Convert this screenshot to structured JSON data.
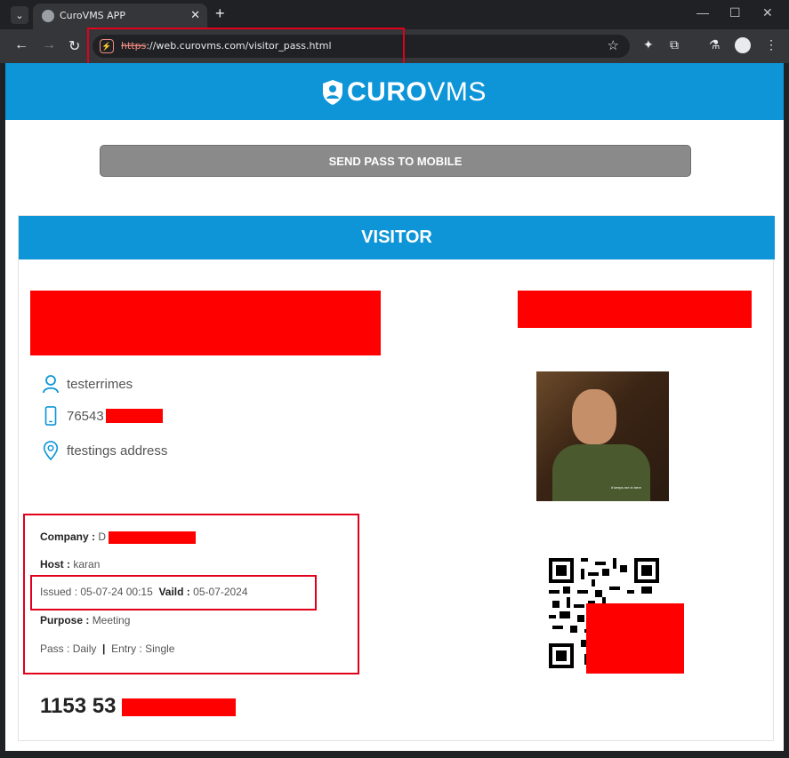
{
  "browser": {
    "tab_title": "CuroVMS APP",
    "tab_close": "✕",
    "new_tab": "+",
    "url_scheme": "https",
    "url_rest": "://web.curovms.com/visitor_pass.html"
  },
  "header": {
    "logo_bold": "CURO",
    "logo_thin": "VMS"
  },
  "actions": {
    "send_pass_label": "SEND PASS TO MOBILE"
  },
  "pass": {
    "title": "VISITOR",
    "visitor_name": "testerrimes",
    "phone": "76543",
    "address": "ftestings address",
    "company_label": "Company :",
    "company_value": "D",
    "host_label": "Host :",
    "host_value": "karan",
    "issued_label": "Issued :",
    "issued_value": "05-07-24 00:15",
    "valid_label": "Vaild :",
    "valid_value": "05-07-2024",
    "purpose_label": "Purpose :",
    "purpose_value": "Meeting",
    "pass_label": "Pass :",
    "pass_value": "Daily",
    "separator": "|",
    "entry_label": "Entry :",
    "entry_value": "Single",
    "pass_number": "1153 53"
  },
  "photo": {
    "caption": "it keeps me in here"
  },
  "colors": {
    "brand_blue": "#0d95d8",
    "button_gray": "#8a8a8a",
    "redaction": "#ff0000"
  },
  "icons": [
    "user-icon",
    "phone-icon",
    "location-pin-icon",
    "qr-code-icon",
    "shield-logo-icon"
  ]
}
